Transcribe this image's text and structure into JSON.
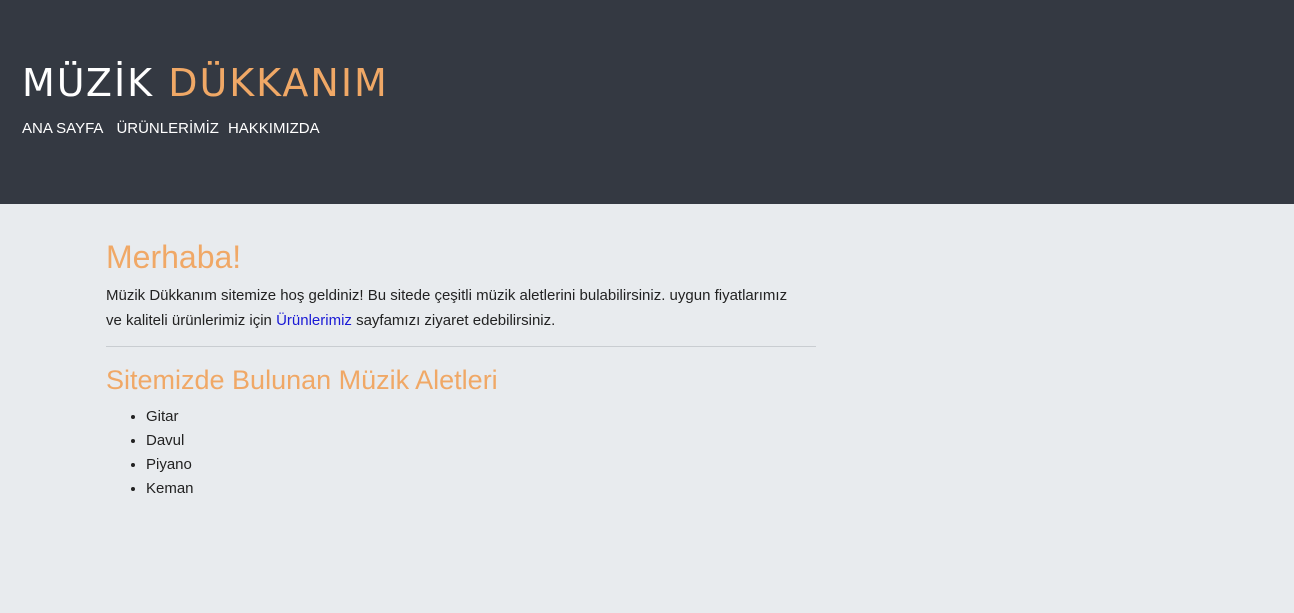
{
  "header": {
    "logo_part1": "MÜZİK",
    "logo_part2": "DÜKKANIM",
    "nav": [
      {
        "label": "ANA SAYFA"
      },
      {
        "label": "ÜRÜNLERİMİZ"
      },
      {
        "label": "HAKKIMIZDA"
      }
    ]
  },
  "main": {
    "heading": "Merhaba!",
    "intro_before": "Müzik Dükkanım sitemize hoş geldiniz! Bu sitede çeşitli müzik aletlerini bulabilirsiniz. uygun fiyatlarımız ve kaliteli ürünlerimiz için ",
    "intro_link": "Ürünlerimiz",
    "intro_after": " sayfamızı ziyaret edebilirsiniz.",
    "subheading": "Sitemizde Bulunan Müzik Aletleri",
    "instruments": [
      "Gitar",
      "Davul",
      "Piyano",
      "Keman"
    ]
  },
  "colors": {
    "header_bg": "#343942",
    "page_bg": "#e8ebee",
    "accent": "#f0a866",
    "link": "#1a1ad6"
  }
}
